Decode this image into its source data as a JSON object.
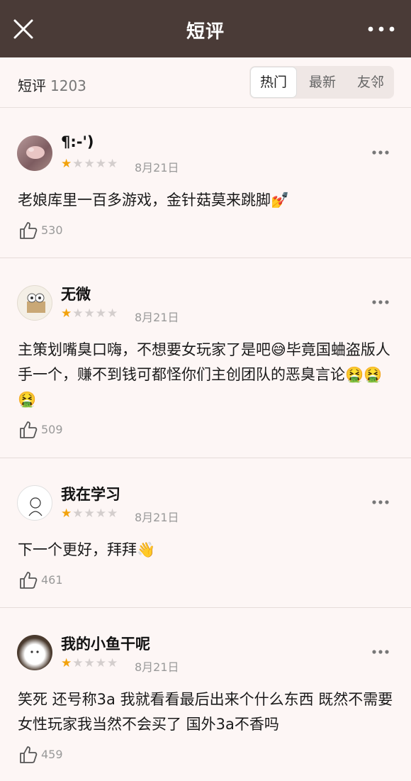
{
  "header": {
    "title": "短评"
  },
  "subheader": {
    "label": "短评",
    "count": "1203",
    "tabs": [
      {
        "label": "热门",
        "active": true
      },
      {
        "label": "最新",
        "active": false
      },
      {
        "label": "友邻",
        "active": false
      }
    ]
  },
  "colors": {
    "header_bg": "#4a3b37",
    "page_bg": "#fdf6f5",
    "star_active": "#f2a20c"
  },
  "reviews": [
    {
      "name": "¶:-')",
      "rating": 1,
      "max_rating": 5,
      "date": "8月21日",
      "content": "老娘库里一百多游戏，金针菇莫来跳脚💅",
      "likes": "530"
    },
    {
      "name": "无微",
      "rating": 1,
      "max_rating": 5,
      "date": "8月21日",
      "content": "主策划嘴臭口嗨，不想要女玩家了是吧😅毕竟国蛐盗版人手一个，赚不到钱可都怪你们主创团队的恶臭言论🤮🤮🤮",
      "likes": "509"
    },
    {
      "name": "我在学习",
      "rating": 1,
      "max_rating": 5,
      "date": "8月21日",
      "content": "下一个更好，拜拜👋",
      "likes": "461"
    },
    {
      "name": "我的小鱼干呢",
      "rating": 1,
      "max_rating": 5,
      "date": "8月21日",
      "content": "笑死 还号称3a 我就看看最后出来个什么东西 既然不需要女性玩家我当然不会买了 国外3a不香吗",
      "likes": "459"
    }
  ]
}
